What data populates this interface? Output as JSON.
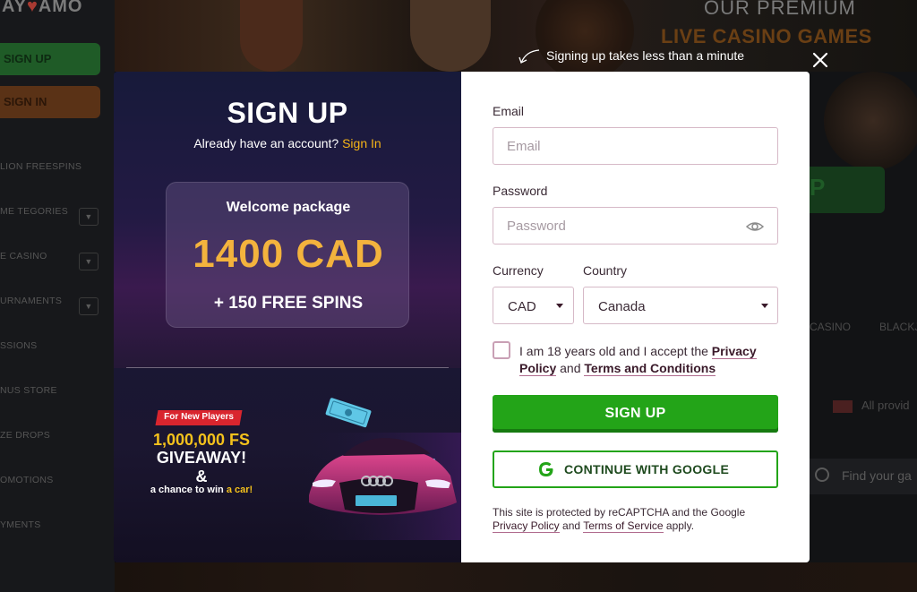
{
  "background": {
    "logo_left": "AY",
    "logo_right": "AMO",
    "sidebar_buttons": {
      "signup": "SIGN UP",
      "signin": "SIGN IN"
    },
    "sidebar_menu": [
      "LION FREESPINS",
      "ME TEGORIES",
      "E CASINO",
      "URNAMENTS",
      "SSIONS",
      "NUS STORE",
      "ZE DROPS",
      "OMOTIONS",
      "YMENTS"
    ],
    "hero_heading": "OUR PREMIUM",
    "hero_subheading": "LIVE CASINO GAMES",
    "right_button": "P",
    "right_labels": {
      "casino": "CASINO",
      "blackjack": "BLACKJ"
    },
    "providers": "All provid",
    "search_placeholder": "Find your ga"
  },
  "caption": "Signing up takes less than a minute",
  "promo": {
    "title": "SIGN UP",
    "have_account": "Already have an account?",
    "signin_link": "Sign In",
    "package_title": "Welcome package",
    "package_amount": "1400 CAD",
    "package_spins": "+ 150 FREE SPINS",
    "badge": "For New Players",
    "fs_amount": "1,000,000 FS",
    "fs_giveaway": "GIVEAWAY!",
    "fs_amp": "&",
    "fs_chance": "a chance to win",
    "fs_car": "a car!"
  },
  "form": {
    "email_label": "Email",
    "email_placeholder": "Email",
    "email_value": "",
    "password_label": "Password",
    "password_placeholder": "Password",
    "password_value": "",
    "currency_label": "Currency",
    "currency_value": "CAD",
    "country_label": "Country",
    "country_value": "Canada",
    "terms_prefix": "I am 18 years old and I accept the",
    "terms_privacy": "Privacy Policy",
    "terms_and": "and",
    "terms_conditions": "Terms and Conditions",
    "signup_button": "SIGN UP",
    "google_button": "CONTINUE WITH GOOGLE",
    "recaptcha_text": "This site is protected by reCAPTCHA and the Google",
    "recaptcha_privacy": "Privacy Policy",
    "recaptcha_and": "and",
    "recaptcha_terms": "Terms of Service",
    "recaptcha_apply": "apply."
  },
  "colors": {
    "accent_green": "#23a418",
    "accent_gold": "#f3b33d",
    "signin_link": "#f5b417",
    "badge_red": "#d9252e"
  },
  "icons": [
    "curved-arrow-icon",
    "close-icon",
    "eye-icon",
    "chevron-down-icon",
    "google-g-icon",
    "checkbox-icon",
    "search-icon"
  ]
}
